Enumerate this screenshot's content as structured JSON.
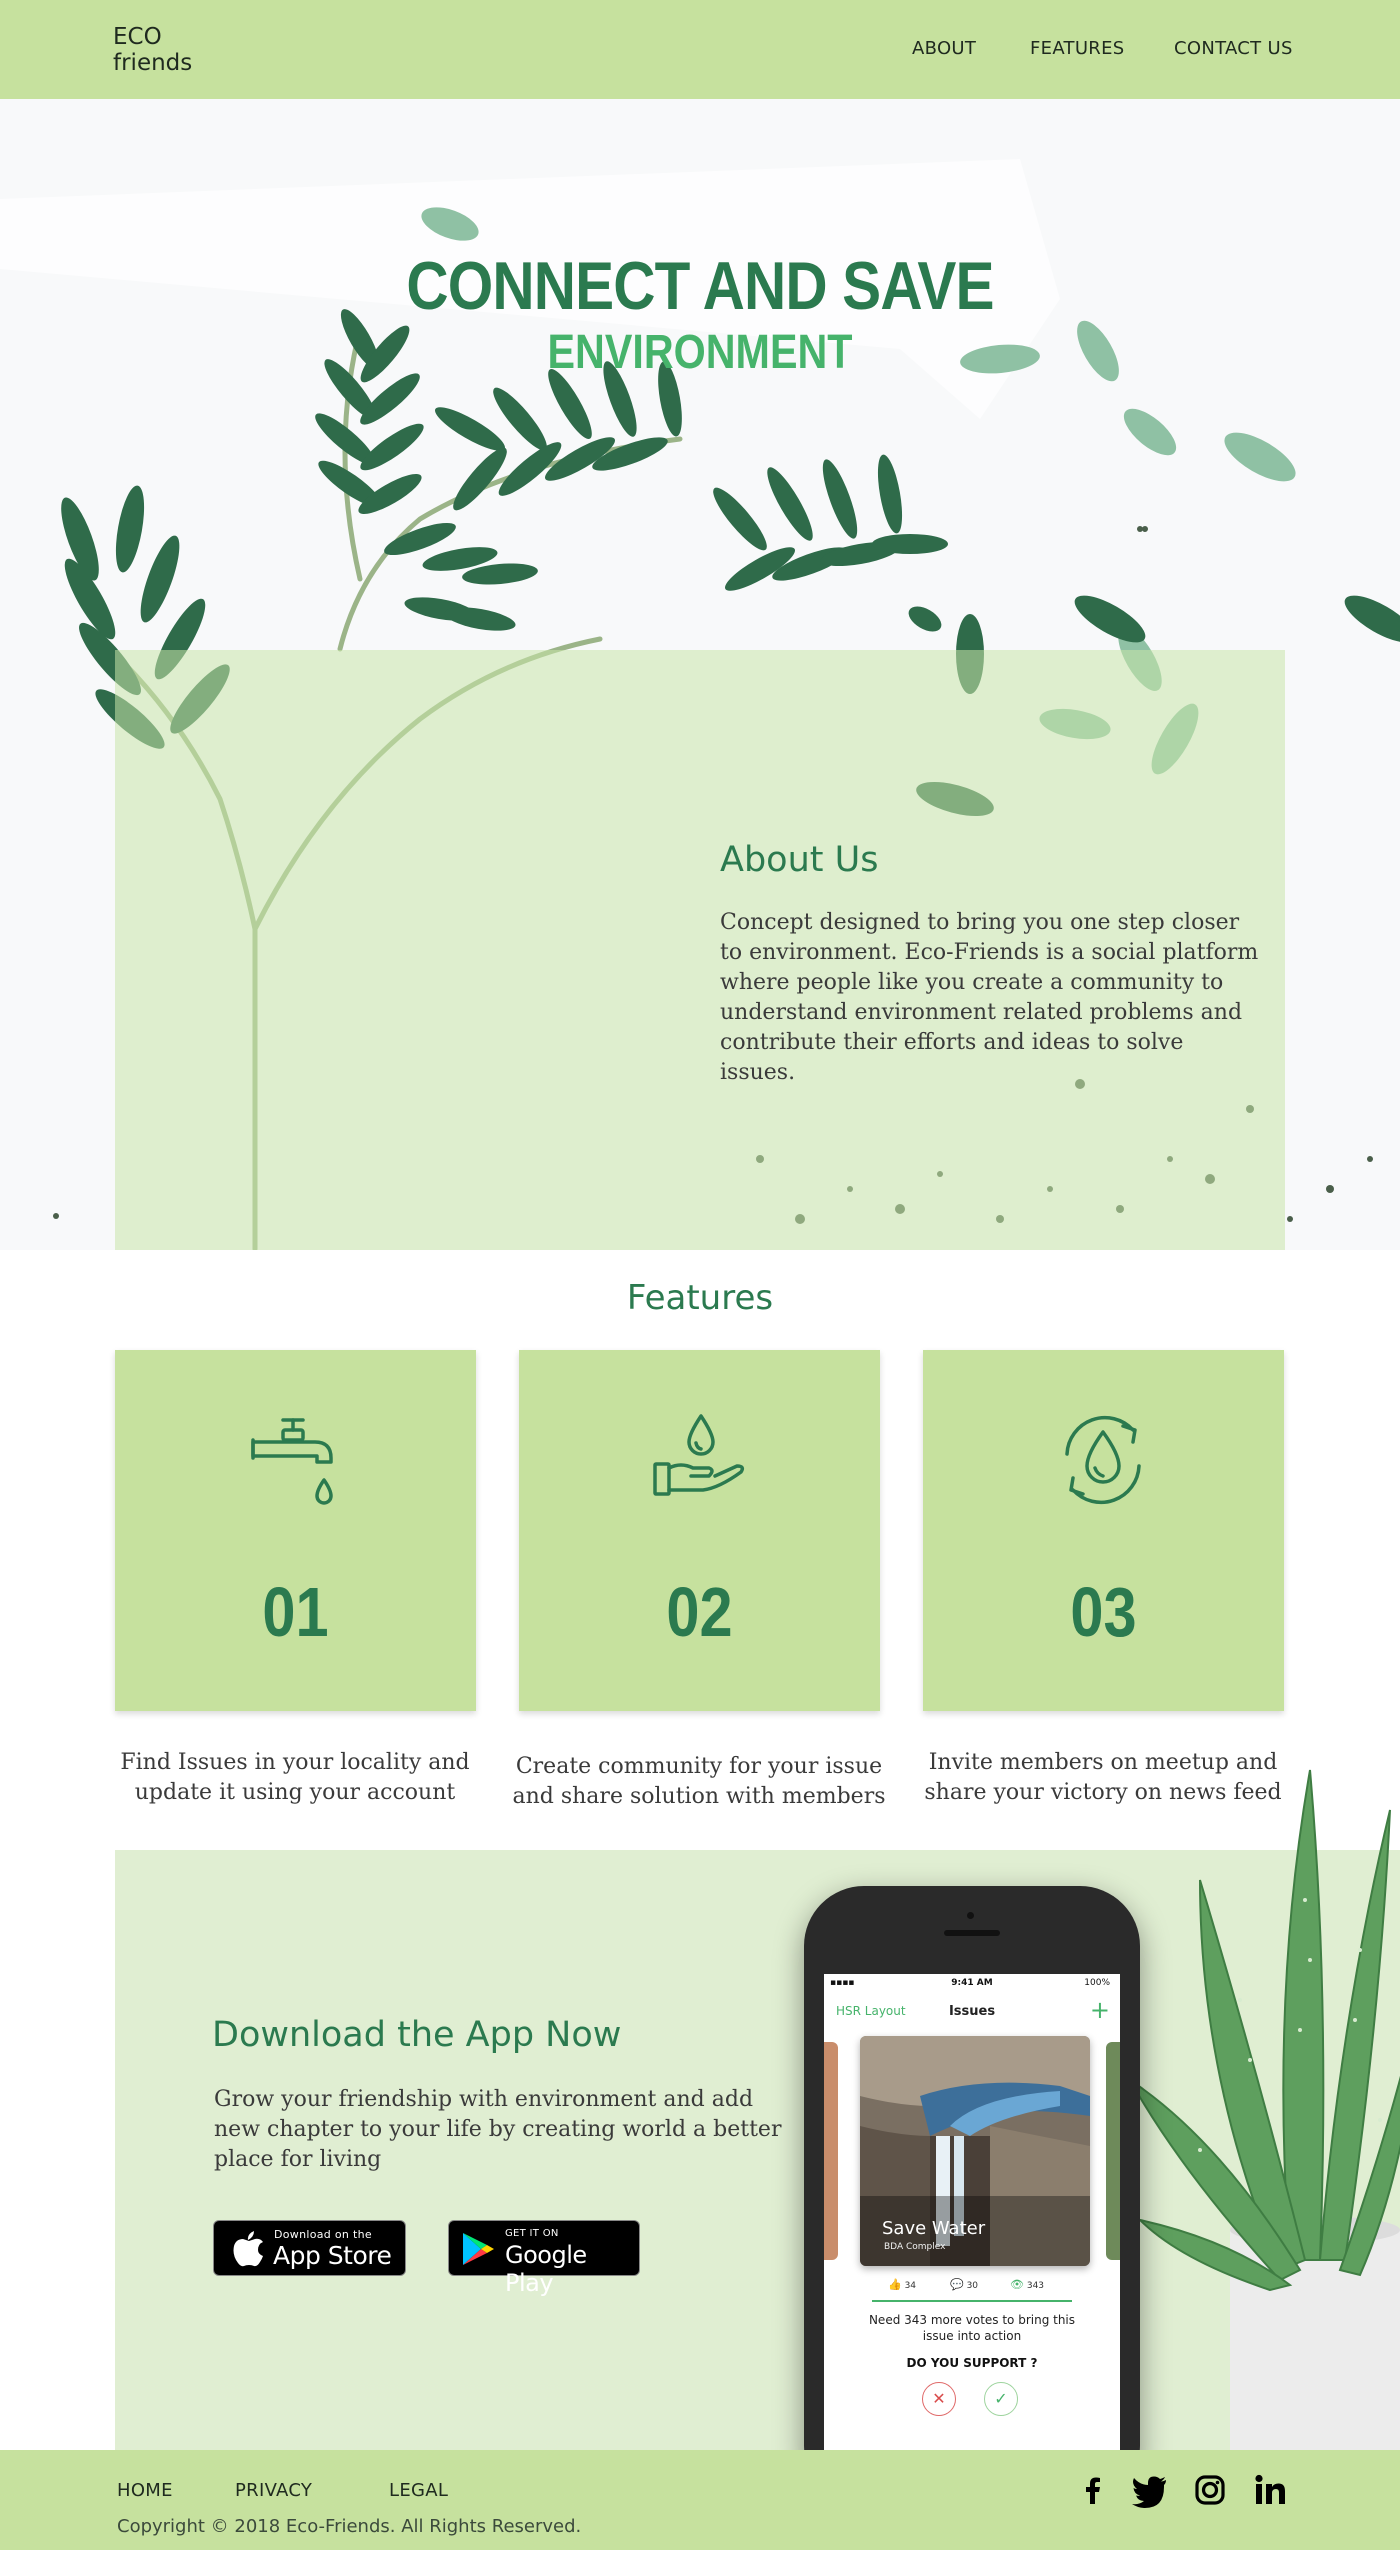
{
  "header": {
    "logo_line1": "ECO",
    "logo_line2": "friends",
    "nav": [
      "ABOUT",
      "FEATURES",
      "CONTACT US"
    ]
  },
  "hero": {
    "title": "CONNECT AND SAVE",
    "subtitle": "ENVIRONMENT"
  },
  "about": {
    "title": "About Us",
    "text": "Concept designed to bring you one step closer to environment. Eco-Friends is a social platform where people like you create a community to understand environment related problems and contribute their efforts and ideas to solve issues."
  },
  "features": {
    "title": "Features",
    "items": [
      {
        "icon": "water-tap-icon",
        "number": "01",
        "desc": "Find Issues in your locality and update it using your account"
      },
      {
        "icon": "hand-water-drop-icon",
        "number": "02",
        "desc": "Create community for your issue and share solution with members"
      },
      {
        "icon": "recycle-water-drop-icon",
        "number": "03",
        "desc": "Invite members on meetup and share your victory on news feed"
      }
    ]
  },
  "download": {
    "title": "Download the App Now",
    "text": "Grow your friendship with environment and add new chapter to your life by creating world a better place for living",
    "appstore_small": "Download on the",
    "appstore_big": "App Store",
    "playstore_small": "GET IT ON",
    "playstore_big": "Google Play"
  },
  "phone": {
    "time": "9:41 AM",
    "battery": "100%",
    "location": "HSR Layout",
    "header": "Issues",
    "add": "+",
    "issue_title": "Save Water",
    "issue_location": "BDA Complex",
    "likes": "34",
    "comments": "30",
    "views": "343",
    "need_text": "Need 343 more votes to bring this issue into action",
    "support": "DO YOU SUPPORT ?",
    "no": "✕",
    "yes": "✓"
  },
  "footer": {
    "links": [
      "HOME",
      "PRIVACY",
      "LEGAL"
    ],
    "copyright": "Copyright © 2018 Eco-Friends. All Rights Reserved.",
    "social": [
      "facebook-icon",
      "twitter-icon",
      "instagram-icon",
      "linkedin-icon"
    ]
  },
  "colors": {
    "brand_light": "#c6e19e",
    "brand_dark": "#2b7a4f",
    "brand_accent": "#46b36b"
  }
}
